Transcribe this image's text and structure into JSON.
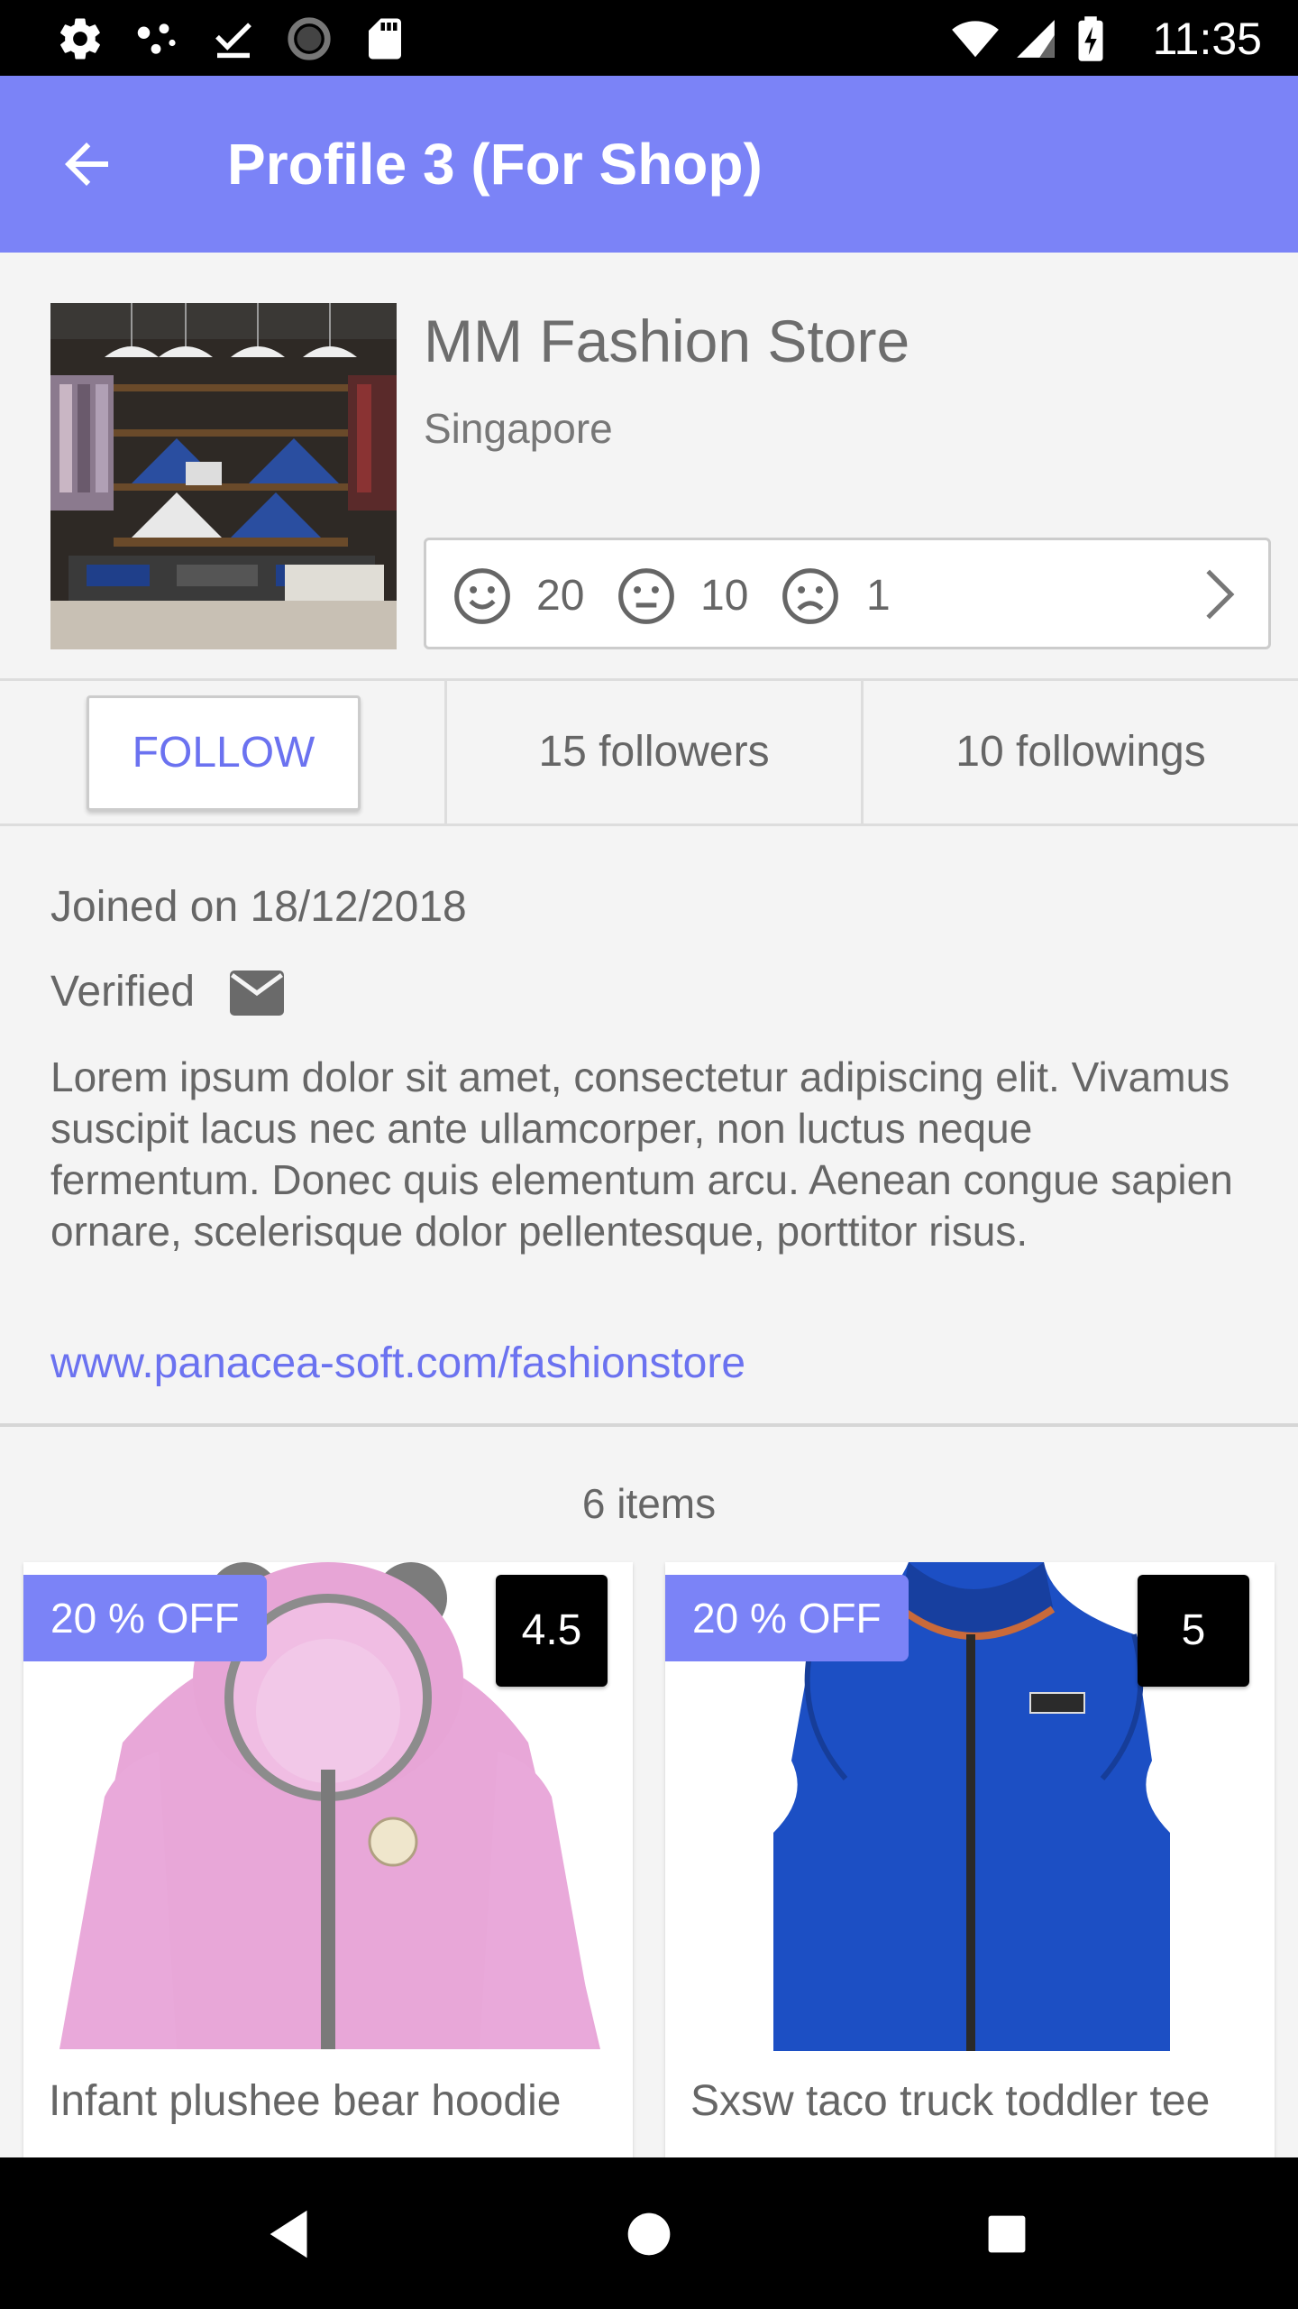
{
  "status_bar": {
    "time": "11:35",
    "left_icons": [
      "settings-icon",
      "dots-icon",
      "download-done-icon",
      "loading-icon",
      "sd-card-icon"
    ],
    "right_icons": [
      "wifi-icon",
      "signal-icon",
      "battery-charging-icon"
    ]
  },
  "app_bar": {
    "title": "Profile 3 (For Shop)",
    "back_icon": "arrow-back-icon",
    "color": "#7b83f7"
  },
  "profile": {
    "name": "MM Fashion Store",
    "location": "Singapore",
    "ratings": {
      "positive": "20",
      "neutral": "10",
      "negative": "1"
    }
  },
  "stats": {
    "follow_label": "FOLLOW",
    "followers": "15 followers",
    "followings": "10 followings"
  },
  "info": {
    "joined": "Joined on 18/12/2018",
    "verified": "Verified",
    "description": "Lorem ipsum dolor sit amet, consectetur adipiscing elit. Vivamus suscipit lacus nec ante ullamcorper, non luctus neque fermentum. Donec quis elementum arcu. Aenean congue sapien ornare, scelerisque dolor pellentesque, porttitor risus.",
    "website": "www.panacea-soft.com/fashionstore"
  },
  "items": {
    "count": "6 items",
    "list": [
      {
        "discount": "20 % OFF",
        "rating": "4.5",
        "name": "Infant plushee bear hoodie"
      },
      {
        "discount": "20 % OFF",
        "rating": "5",
        "name": "Sxsw taco truck toddler tee"
      }
    ]
  },
  "nav_bar": {
    "buttons": [
      "nav-back-icon",
      "nav-home-icon",
      "nav-recents-icon"
    ]
  },
  "colors": {
    "accent": "#7b83f7",
    "link": "#6b72f0",
    "status_bar": "#000000"
  }
}
